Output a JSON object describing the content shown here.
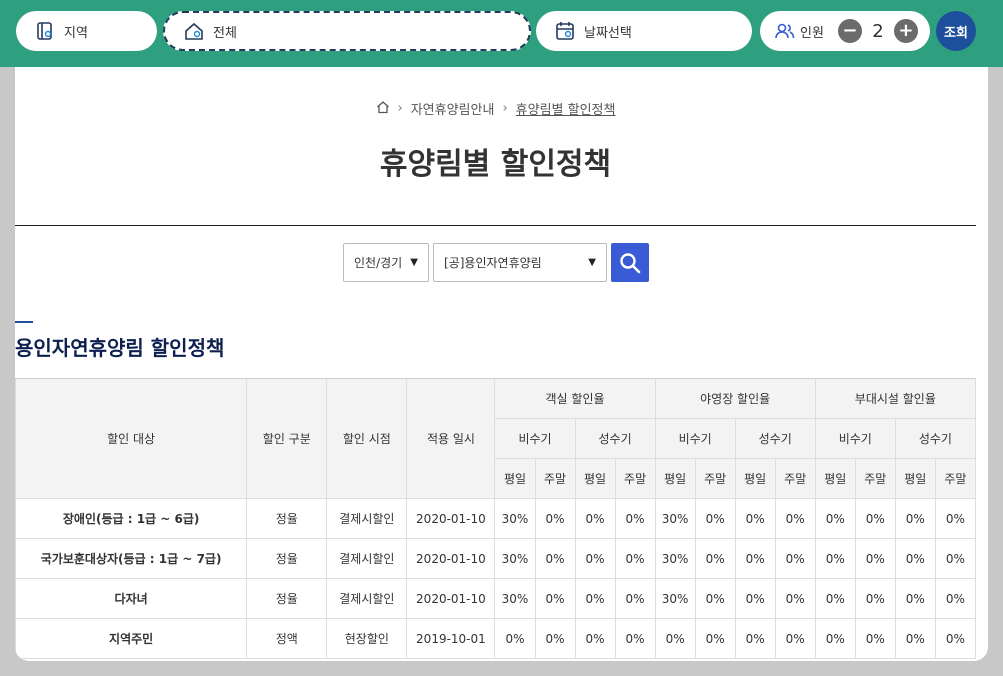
{
  "searchbar": {
    "region": "지역",
    "area": "전체",
    "date": "날짜선택",
    "people_label": "인원",
    "people_count": "2",
    "minus": "−",
    "plus": "+",
    "submit": "조회"
  },
  "breadcrumb": {
    "home_icon": "home-icon",
    "items": [
      "자연휴양림안내",
      "휴양림별 할인정책"
    ]
  },
  "page_title": "휴양림별 할인정책",
  "filters": {
    "region_value": "인천/경기",
    "forest_value": "[공]용인자연휴양림"
  },
  "section_title": "용인자연휴양림 할인정책",
  "table": {
    "headers": {
      "target": "할인 대상",
      "type": "할인 구분",
      "timing": "할인 시점",
      "date": "적용 일시",
      "room": "객실 할인율",
      "camp": "야영장 할인율",
      "facility": "부대시설 할인율",
      "off_season": "비수기",
      "peak_season": "성수기",
      "weekday": "평일",
      "weekend": "주말"
    },
    "rows": [
      {
        "target": "장애인(등급 : 1급 ~ 6급)",
        "type": "정율",
        "timing": "결제시할인",
        "date": "2020-01-10",
        "rates": [
          "30%",
          "0%",
          "0%",
          "0%",
          "30%",
          "0%",
          "0%",
          "0%",
          "0%",
          "0%",
          "0%",
          "0%"
        ]
      },
      {
        "target": "국가보훈대상자(등급 : 1급 ~ 7급)",
        "type": "정율",
        "timing": "결제시할인",
        "date": "2020-01-10",
        "rates": [
          "30%",
          "0%",
          "0%",
          "0%",
          "30%",
          "0%",
          "0%",
          "0%",
          "0%",
          "0%",
          "0%",
          "0%"
        ]
      },
      {
        "target": "다자녀",
        "type": "정율",
        "timing": "결제시할인",
        "date": "2020-01-10",
        "rates": [
          "30%",
          "0%",
          "0%",
          "0%",
          "30%",
          "0%",
          "0%",
          "0%",
          "0%",
          "0%",
          "0%",
          "0%"
        ]
      },
      {
        "target": "지역주민",
        "type": "정액",
        "timing": "현장할인",
        "date": "2019-10-01",
        "rates": [
          "0%",
          "0%",
          "0%",
          "0%",
          "0%",
          "0%",
          "0%",
          "0%",
          "0%",
          "0%",
          "0%",
          "0%"
        ]
      }
    ]
  },
  "colors": {
    "topbar": "#2fa07f",
    "submit": "#1e4f9c",
    "search_button": "#3a5bd6",
    "section_title": "#0d1f4f"
  }
}
